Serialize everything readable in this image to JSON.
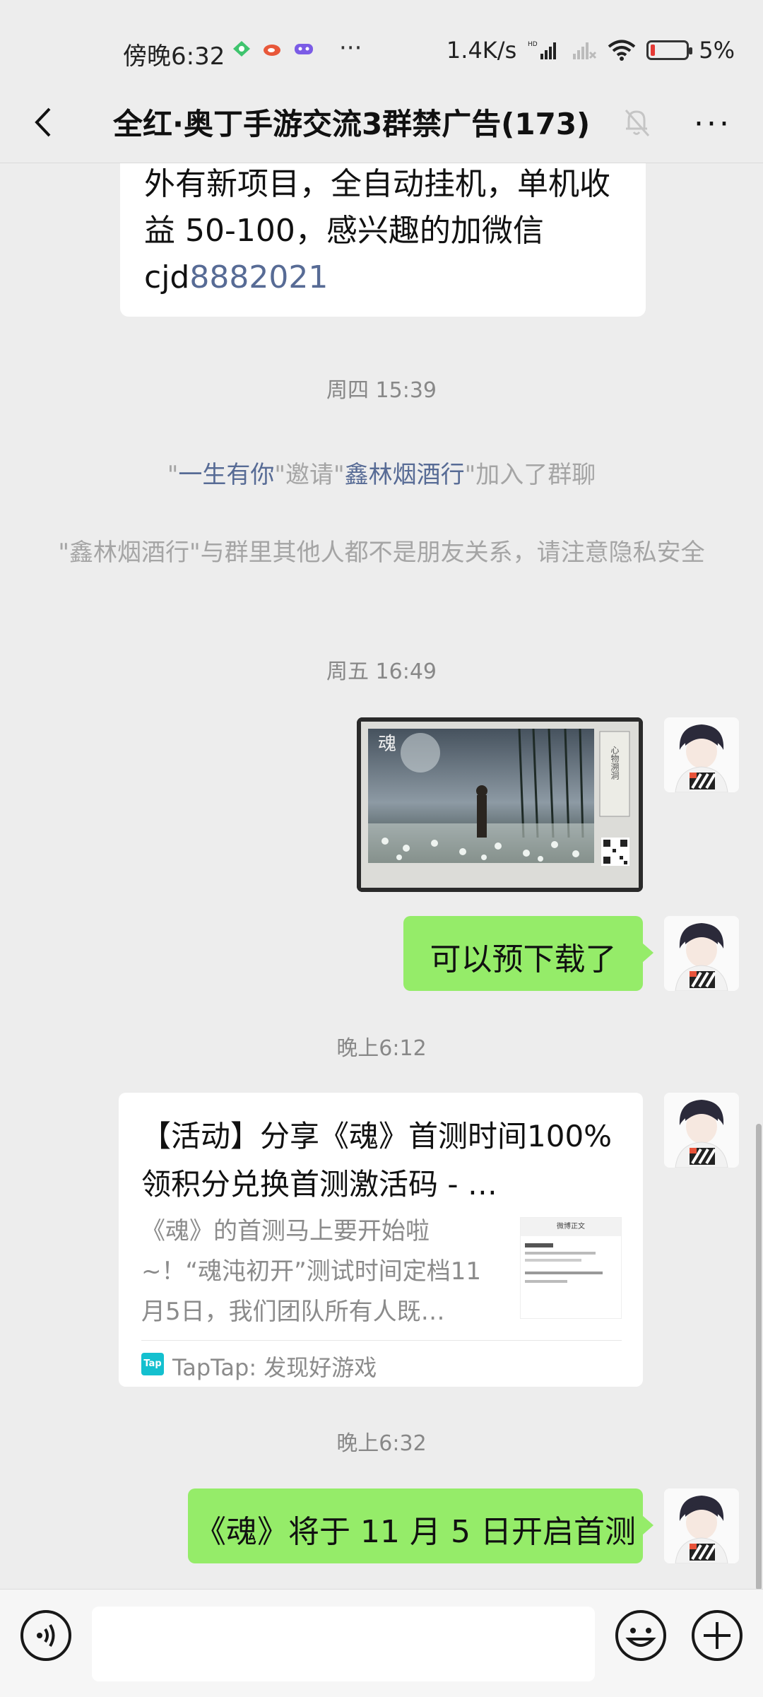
{
  "status_bar": {
    "time": "傍晚6:32",
    "speed": "1.4K/s",
    "network": "HD",
    "battery": "5%"
  },
  "header": {
    "title": "全红·奥丁手游交流3群禁广告(173)"
  },
  "messages": {
    "top_partial": {
      "line1": "外有新项目，全自动挂机，单机收",
      "line2": "益 50-100，感兴趣的加微信",
      "line3_prefix": "cjd",
      "line3_link": "8882021"
    },
    "ts1": "周四 15:39",
    "invite": {
      "q1": "\"",
      "inviter": "一生有你",
      "mid": "\"邀请\"",
      "invitee": "鑫林烟酒行",
      "end": "\"加入了群聊"
    },
    "privacy_notice": "\"鑫林烟酒行\"与群里其他人都不是朋友关系，请注意隐私安全",
    "ts2": "周五 16:49",
    "image_msg": {
      "logo_text": "魂",
      "side_text": "心物溯洞"
    },
    "msg_download": "可以预下载了",
    "ts3": "晚上6:12",
    "link_card": {
      "title": "【活动】分享《魂》首测时间100%领积分兑换首测激活码 - …",
      "desc": "《魂》的首测马上要开始啦~！“魂沌初开”测试时间定档11月5日，我们团队所有人既…",
      "thumb_header": "微博正文",
      "source_icon": "Tap",
      "source": "TapTap: 发现好游戏"
    },
    "ts4": "晚上6:32",
    "msg_test": "《魂》将于 11 月 5 日开启首测"
  },
  "colors": {
    "bg": "#ededed",
    "green_bubble": "#95ec69",
    "link": "#576b95",
    "taptap": "#14c0cf"
  }
}
